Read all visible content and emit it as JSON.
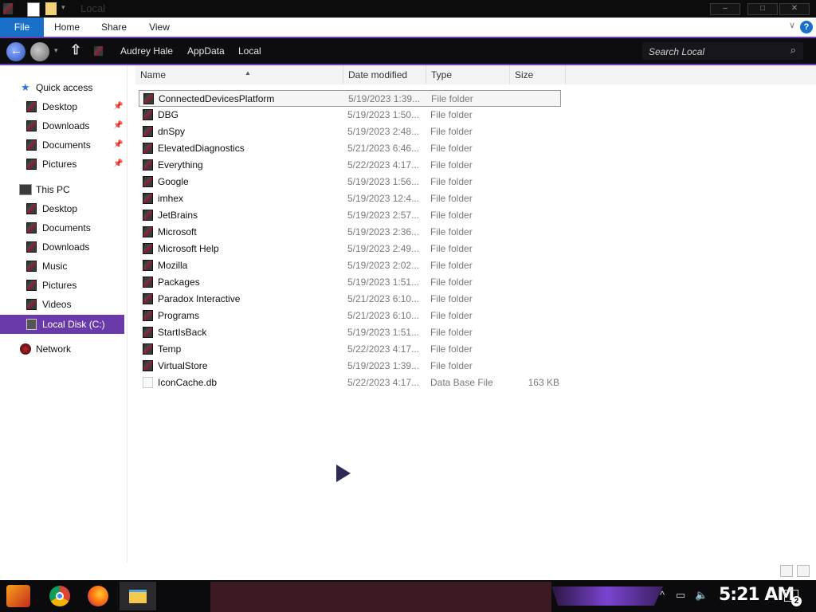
{
  "window": {
    "title": "Local",
    "minimize": "–",
    "maximize": "□",
    "close": "✕"
  },
  "ribbon": {
    "tabs": [
      "File",
      "Home",
      "Share",
      "View"
    ],
    "help": "?"
  },
  "address": {
    "breadcrumbs": [
      "Audrey Hale",
      "AppData",
      "Local"
    ],
    "search_placeholder": "Search Local"
  },
  "nav": {
    "quick_access": "Quick access",
    "quick_items": [
      "Desktop",
      "Downloads",
      "Documents",
      "Pictures"
    ],
    "this_pc": "This PC",
    "pc_items": [
      "Desktop",
      "Documents",
      "Downloads",
      "Music",
      "Pictures",
      "Videos",
      "Local Disk (C:)"
    ],
    "network": "Network"
  },
  "columns": [
    "Name",
    "Date modified",
    "Type",
    "Size"
  ],
  "files": [
    {
      "name": "ConnectedDevicesPlatform",
      "date": "5/19/2023 1:39...",
      "type": "File folder",
      "size": ""
    },
    {
      "name": "DBG",
      "date": "5/19/2023 1:50...",
      "type": "File folder",
      "size": ""
    },
    {
      "name": "dnSpy",
      "date": "5/19/2023 2:48...",
      "type": "File folder",
      "size": ""
    },
    {
      "name": "ElevatedDiagnostics",
      "date": "5/21/2023 6:46...",
      "type": "File folder",
      "size": ""
    },
    {
      "name": "Everything",
      "date": "5/22/2023 4:17...",
      "type": "File folder",
      "size": ""
    },
    {
      "name": "Google",
      "date": "5/19/2023 1:56...",
      "type": "File folder",
      "size": ""
    },
    {
      "name": "imhex",
      "date": "5/19/2023 12:4...",
      "type": "File folder",
      "size": ""
    },
    {
      "name": "JetBrains",
      "date": "5/19/2023 2:57...",
      "type": "File folder",
      "size": ""
    },
    {
      "name": "Microsoft",
      "date": "5/19/2023 2:36...",
      "type": "File folder",
      "size": ""
    },
    {
      "name": "Microsoft Help",
      "date": "5/19/2023 2:49...",
      "type": "File folder",
      "size": ""
    },
    {
      "name": "Mozilla",
      "date": "5/19/2023 2:02...",
      "type": "File folder",
      "size": ""
    },
    {
      "name": "Packages",
      "date": "5/19/2023 1:51...",
      "type": "File folder",
      "size": ""
    },
    {
      "name": "Paradox Interactive",
      "date": "5/21/2023 6:10...",
      "type": "File folder",
      "size": ""
    },
    {
      "name": "Programs",
      "date": "5/21/2023 6:10...",
      "type": "File folder",
      "size": ""
    },
    {
      "name": "StartIsBack",
      "date": "5/19/2023 1:51...",
      "type": "File folder",
      "size": ""
    },
    {
      "name": "Temp",
      "date": "5/22/2023 4:17...",
      "type": "File folder",
      "size": ""
    },
    {
      "name": "VirtualStore",
      "date": "5/19/2023 1:39...",
      "type": "File folder",
      "size": ""
    },
    {
      "name": "IconCache.db",
      "date": "5/22/2023 4:17...",
      "type": "Data Base File",
      "size": "163 KB"
    }
  ],
  "selected_file": "ConnectedDevicesPlatform",
  "taskbar": {
    "clock": "5:21 AM",
    "notification_count": "2",
    "apps": [
      "chrome-icon",
      "firefox-icon",
      "file-explorer-icon"
    ]
  },
  "colors": {
    "accent": "#6a3aaa",
    "file_tab": "#1a6fc8",
    "folder_red": "#b01030"
  }
}
